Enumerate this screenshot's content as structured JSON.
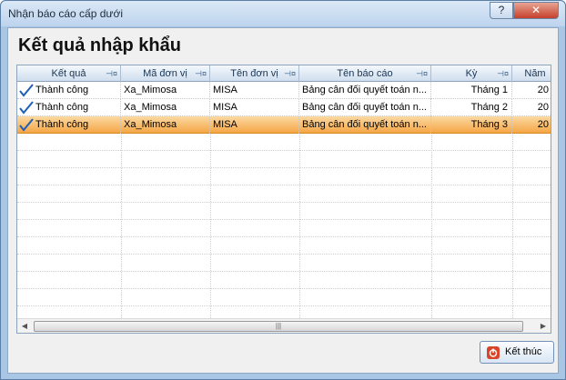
{
  "window": {
    "title": "Nhận báo cáo cấp dưới",
    "help_label": "?",
    "close_label": "✕"
  },
  "heading": "Kết quả nhập khẩu",
  "grid": {
    "columns": [
      {
        "label": "Kết quả"
      },
      {
        "label": "Mã đơn vị"
      },
      {
        "label": "Tên đơn vị"
      },
      {
        "label": "Tên báo cáo"
      },
      {
        "label": "Kỳ"
      },
      {
        "label": "Năm"
      }
    ],
    "rows": [
      {
        "result": "Thành công",
        "unit_code": "Xa_Mimosa",
        "unit_name": "MISA",
        "report_name": "Bảng cân đối quyết toán n...",
        "period": "Tháng 1",
        "year": "20",
        "selected": false
      },
      {
        "result": "Thành công",
        "unit_code": "Xa_Mimosa",
        "unit_name": "MISA",
        "report_name": "Bảng cân đối quyết toán n...",
        "period": "Tháng 2",
        "year": "20",
        "selected": false
      },
      {
        "result": "Thành công",
        "unit_code": "Xa_Mimosa",
        "unit_name": "MISA",
        "report_name": "Bảng cân đối quyết toán n...",
        "period": "Tháng 3",
        "year": "20",
        "selected": true
      }
    ]
  },
  "buttons": {
    "finish_label": "Kết thúc"
  },
  "colors": {
    "selected_row": "#f5a646",
    "check": "#1f5fb8",
    "finish_icon": "#d9452b"
  }
}
